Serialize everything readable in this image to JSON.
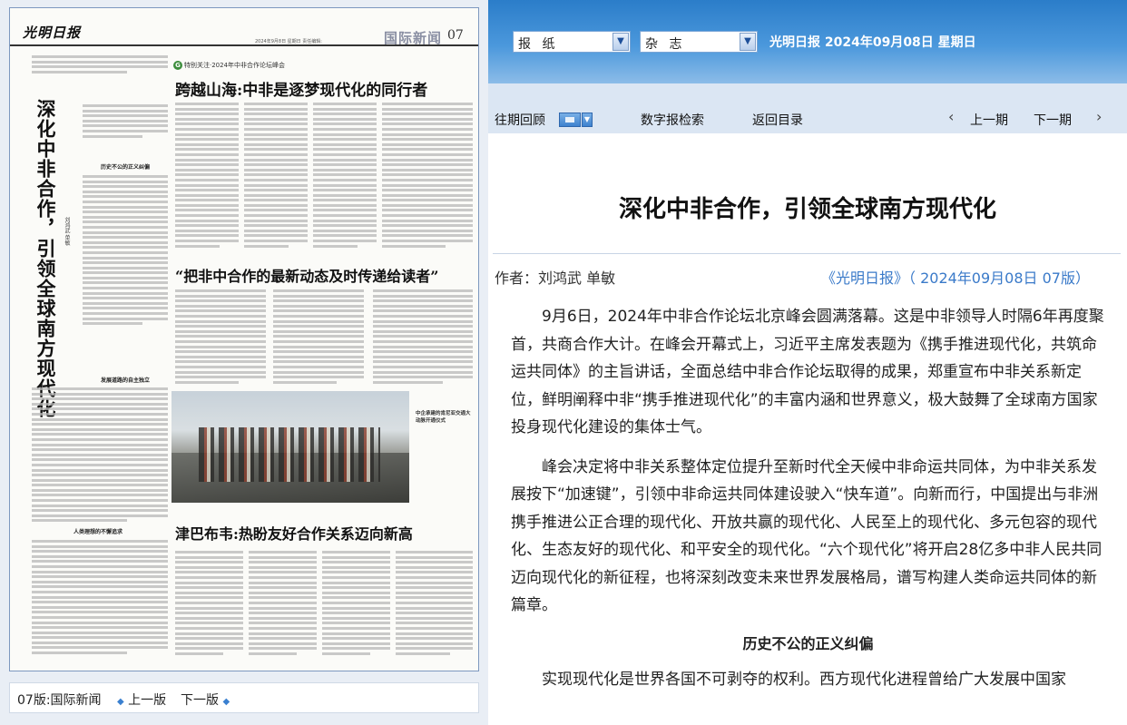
{
  "paper": {
    "masthead": "光明日报",
    "meta": "2024年9月8日 星期日 责任编辑:",
    "section": "国际新闻",
    "page_number": "07",
    "lead_headline": "深化中非合作，引领全球南方现代化",
    "lead_byline": "刘鸿武 单敏",
    "lead_subheads": [
      "历史不公的正义纠偏",
      "发展道路的自主独立",
      "人类理想的不懈追求"
    ],
    "feature_kicker": "特别关注·2024年中非合作论坛峰会",
    "feature_kicker_icon": "G",
    "story1_title": "跨越山海:中非是逐梦现代化的同行者",
    "story2_title": "“把非中合作的最新动态及时传递给读者”",
    "story3_title": "津巴布韦:热盼友好合作关系迈向新高",
    "photo_caption": "中企承建的肯尼亚交通大动脉开通仪式"
  },
  "bottom_bar": {
    "page_label": "07版:国际新闻",
    "prev": "上一版",
    "next": "下一版"
  },
  "toolbar": {
    "select_newspaper": "报 纸",
    "select_magazine": "杂 志",
    "date_line": "光明日报  2024年09月08日  星期日"
  },
  "nav": {
    "past_review": "往期回顾",
    "search": "数字报检索",
    "back_to_index": "返回目录",
    "prev_issue": "上一期",
    "next_issue": "下一期"
  },
  "article": {
    "title": "深化中非合作，引领全球南方现代化",
    "byline": "作者：刘鸿武 单敏",
    "source": "《光明日报》（ 2024年09月08日   07版）",
    "paragraphs": [
      "9月6日，2024年中非合作论坛北京峰会圆满落幕。这是中非领导人时隔6年再度聚首，共商合作大计。在峰会开幕式上，习近平主席发表题为《携手推进现代化，共筑命运共同体》的主旨讲话，全面总结中非合作论坛取得的成果，郑重宣布中非关系新定位，鲜明阐释中非“携手推进现代化”的丰富内涵和世界意义，极大鼓舞了全球南方国家投身现代化建设的集体士气。",
      "峰会决定将中非关系整体定位提升至新时代全天候中非命运共同体，为中非关系发展按下“加速键”，引领中非命运共同体建设驶入“快车道”。向新而行，中国提出与非洲携手推进公正合理的现代化、开放共赢的现代化、人民至上的现代化、多元包容的现代化、生态友好的现代化、和平安全的现代化。“六个现代化”将开启28亿多中非人民共同迈向现代化的新征程，也将深刻改变未来世界发展格局，谱写构建人类命运共同体的新篇章。"
    ],
    "subheading": "历史不公的正义纠偏",
    "paragraph_last": "实现现代化是世界各国不可剥夺的权利。西方现代化进程曾给广大发展中国家"
  },
  "colors": {
    "toolbar_top": "#2b7dc9",
    "nav_band": "#dbe6f3",
    "link_blue": "#3a7ac9"
  }
}
